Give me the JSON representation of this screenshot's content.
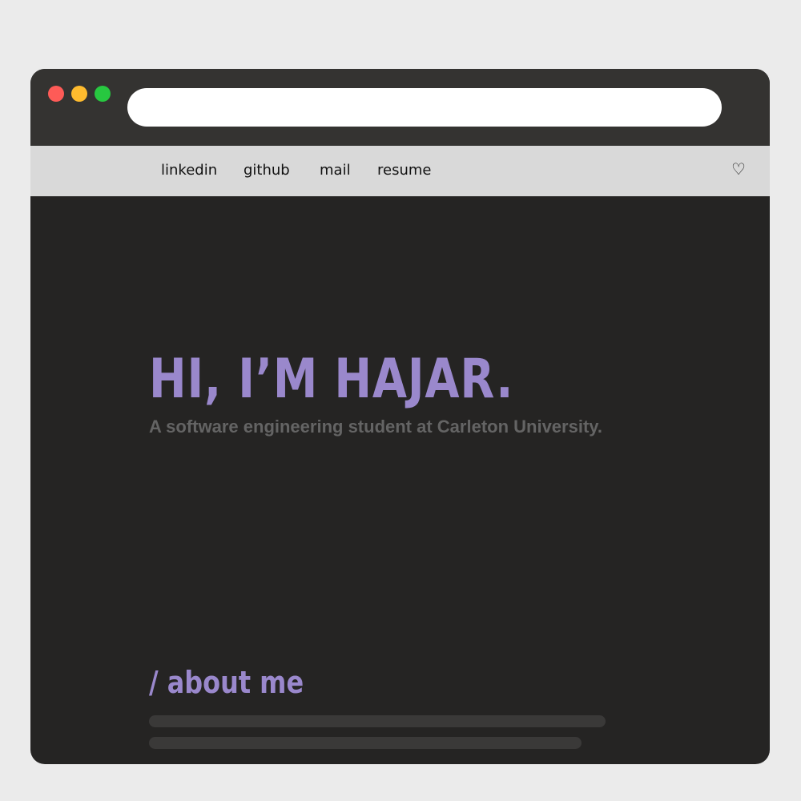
{
  "browser": {
    "address_value": "",
    "traffic_light_colors": {
      "close": "#fe5b57",
      "minimize": "#febb2e",
      "maximize": "#27c840"
    }
  },
  "nav": {
    "links": [
      {
        "label": "linkedin"
      },
      {
        "label": "github"
      },
      {
        "label": "mail"
      },
      {
        "label": "resume"
      }
    ],
    "heart_glyph": "♡",
    "heart_icon": "heart-icon"
  },
  "hero": {
    "title": "HI, I’M HAJAR.",
    "subtitle": "A software engineering student at Carleton University."
  },
  "about": {
    "title": "/ about me"
  },
  "colors": {
    "accent": "#9a88cc",
    "background": "#252423",
    "titlebar": "#343331",
    "navbar": "#d9d9d9",
    "muted_text": "#646464",
    "placeholder": "#3a3938"
  }
}
